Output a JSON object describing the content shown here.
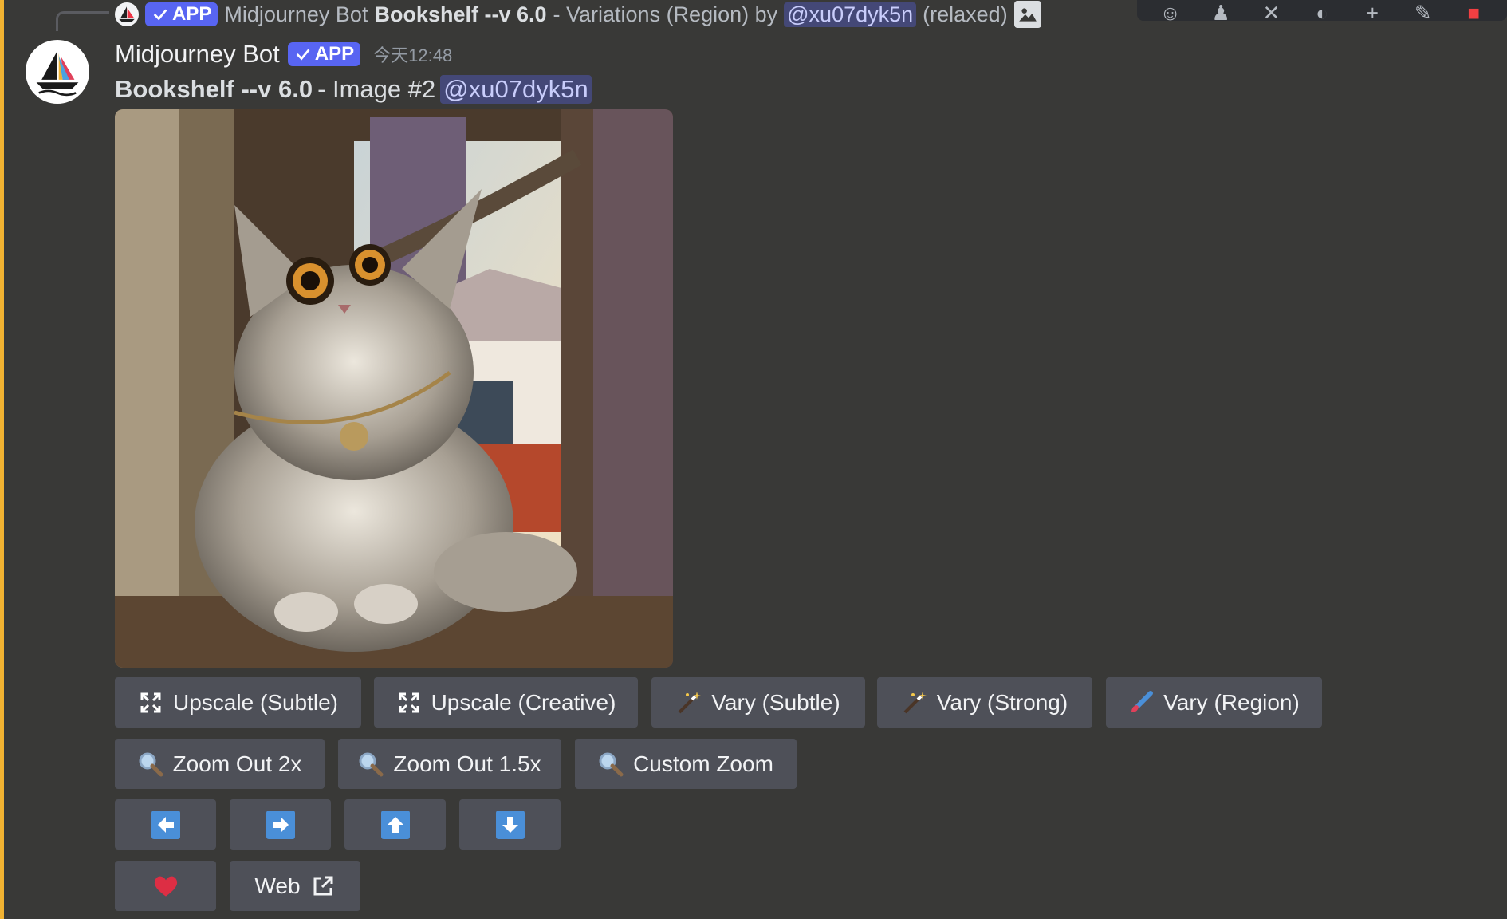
{
  "reply": {
    "app_badge": "APP",
    "author": "Midjourney Bot",
    "prompt": "Bookshelf --v 6.0",
    "action": "- Variations (Region) by",
    "mention": "@xu07dyk5n",
    "mode": "(relaxed)"
  },
  "message": {
    "username": "Midjourney Bot",
    "app_badge": "APP",
    "timestamp": "今天12:48",
    "prompt": "Bookshelf --v 6.0",
    "image_label": "- Image #2",
    "mention": "@xu07dyk5n"
  },
  "buttons": {
    "row1": [
      "Upscale (Subtle)",
      "Upscale (Creative)",
      "Vary (Subtle)",
      "Vary (Strong)",
      "Vary (Region)"
    ],
    "row2": [
      "Zoom Out 2x",
      "Zoom Out 1.5x",
      "Custom Zoom"
    ],
    "web": "Web"
  },
  "icons": {
    "toolbar": [
      "reaction-icon",
      "thread-icon",
      "pin-icon",
      "refresh-icon",
      "plus-icon",
      "edit-icon",
      "delete-icon"
    ],
    "upscale": "expand-arrows-icon",
    "vary": "magic-wand-icon",
    "vary_region": "paintbrush-icon",
    "zoom": "magnifier-icon",
    "pan": [
      "arrow-left-icon",
      "arrow-right-icon",
      "arrow-up-icon",
      "arrow-down-icon"
    ],
    "like": "heart-icon",
    "external": "external-link-icon"
  },
  "colors": {
    "background": "#393937",
    "accent_bar": "#f0b232",
    "app_badge": "#5865f2",
    "button": "#4e5058",
    "arrow_button": "#4a8fd8",
    "heart": "#dd2e44"
  }
}
